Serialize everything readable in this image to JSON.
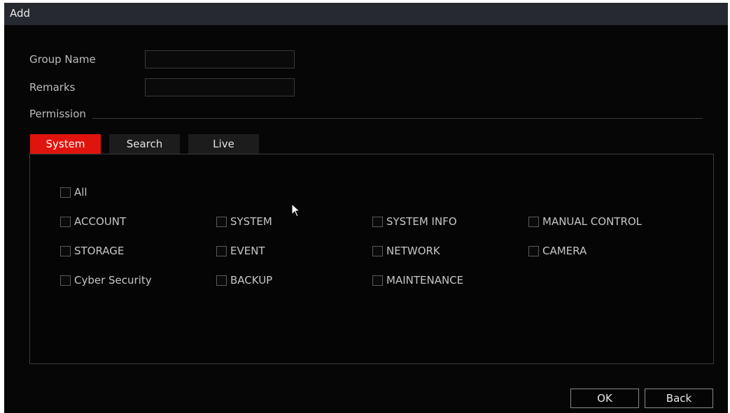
{
  "dialog": {
    "title": "Add"
  },
  "form": {
    "group_name_label": "Group Name",
    "group_name_value": "",
    "remarks_label": "Remarks",
    "remarks_value": "",
    "permission_label": "Permission"
  },
  "tabs": [
    {
      "label": "System",
      "active": true
    },
    {
      "label": "Search",
      "active": false
    },
    {
      "label": "Live",
      "active": false
    }
  ],
  "checkboxes": {
    "all": "All",
    "account": "ACCOUNT",
    "system": "SYSTEM",
    "system_info": "SYSTEM INFO",
    "manual_control": "MANUAL CONTROL",
    "storage": "STORAGE",
    "event": "EVENT",
    "network": "NETWORK",
    "camera": "CAMERA",
    "cyber_security": "Cyber Security",
    "backup": "BACKUP",
    "maintenance": "MAINTENANCE"
  },
  "buttons": {
    "ok": "OK",
    "back": "Back"
  },
  "colors": {
    "accent": "#e0140e",
    "background": "#060606",
    "titlebar": "#262a30"
  },
  "icons": {
    "pointer": "mouse-pointer-icon"
  }
}
